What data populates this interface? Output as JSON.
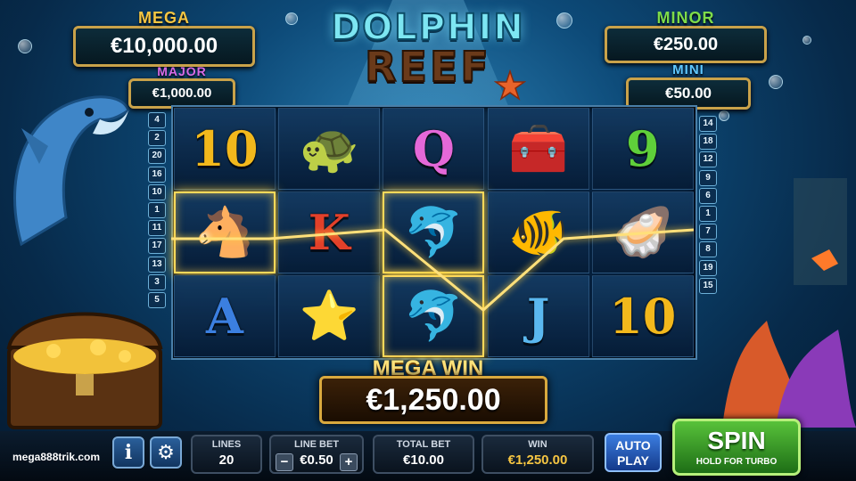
{
  "game": {
    "logo_line1": "DOLPHIN",
    "logo_line2": "REEF"
  },
  "jackpots": {
    "mega": {
      "label": "MEGA",
      "value": "€10,000.00",
      "label_color": "#f5c542"
    },
    "major": {
      "label": "MAJOR",
      "value": "€1,000.00",
      "label_color": "#d86ae6"
    },
    "minor": {
      "label": "MINOR",
      "value": "€250.00",
      "label_color": "#7ddc4a"
    },
    "mini": {
      "label": "MINI",
      "value": "€50.00",
      "label_color": "#5fc8ff"
    }
  },
  "paylines_left": [
    "4",
    "2",
    "20",
    "16",
    "10",
    "1",
    "11",
    "17",
    "13",
    "3",
    "5"
  ],
  "paylines_right": [
    "14",
    "18",
    "12",
    "9",
    "6",
    "1",
    "7",
    "8",
    "19",
    "15"
  ],
  "reels": [
    [
      {
        "kind": "letter",
        "text": "10",
        "color": "#f2b81c",
        "win": false
      },
      {
        "kind": "emoji",
        "text": "🐢",
        "win": false
      },
      {
        "kind": "letter",
        "text": "Q",
        "color": "#e468d8",
        "win": false
      },
      {
        "kind": "emoji",
        "text": "🧰",
        "win": false
      },
      {
        "kind": "letter",
        "text": "9",
        "color": "#5fcf3a",
        "win": false
      }
    ],
    [
      {
        "kind": "emoji",
        "text": "🐴",
        "win": true
      },
      {
        "kind": "letter",
        "text": "K",
        "color": "#e2402a",
        "win": false
      },
      {
        "kind": "emoji",
        "text": "🐬",
        "win": true
      },
      {
        "kind": "emoji",
        "text": "🐠",
        "win": false
      },
      {
        "kind": "emoji",
        "text": "🦪",
        "win": false
      }
    ],
    [
      {
        "kind": "letter",
        "text": "A",
        "color": "#3b7fe0",
        "win": false
      },
      {
        "kind": "emoji",
        "text": "⭐",
        "win": false
      },
      {
        "kind": "emoji",
        "text": "🐬",
        "win": true
      },
      {
        "kind": "letter",
        "text": "J",
        "color": "#5ab8f0",
        "win": false
      },
      {
        "kind": "letter",
        "text": "10",
        "color": "#f2b81c",
        "win": false
      }
    ]
  ],
  "win_banner": {
    "label": "MEGA WIN",
    "amount": "€1,250.00"
  },
  "controls": {
    "site": "mega888trik.com",
    "info_icon": "info-icon",
    "settings_icon": "gear-icon",
    "lines": {
      "label": "LINES",
      "value": "20"
    },
    "line_bet": {
      "label": "LINE BET",
      "value": "€0.50",
      "minus": "−",
      "plus": "+"
    },
    "total_bet": {
      "label": "TOTAL BET",
      "value": "€10.00"
    },
    "win": {
      "label": "WIN",
      "value": "€1,250.00",
      "color": "#f5c542"
    },
    "auto_play": {
      "line1": "AUTO",
      "line2": "PLAY"
    },
    "spin": {
      "label": "SPIN",
      "sub": "HOLD FOR TURBO"
    }
  }
}
